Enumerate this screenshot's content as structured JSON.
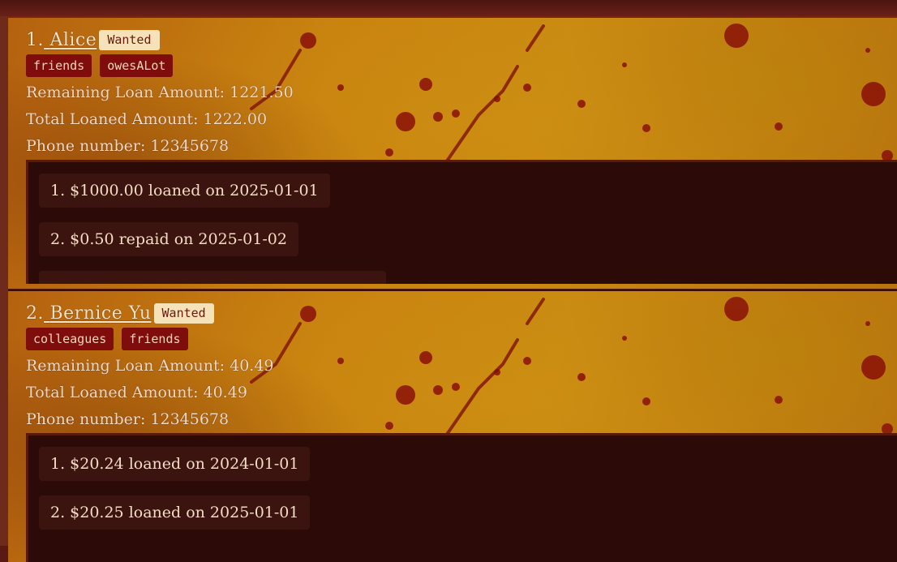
{
  "debtors": [
    {
      "index": "1.",
      "name": "Alice",
      "badge": "Wanted",
      "tags": [
        "friends",
        "owesALot"
      ],
      "remaining_label": "Remaining Loan Amount: 1221.50",
      "total_label": "Total Loaned Amount: 1222.00",
      "phone_label": "Phone number: 12345678",
      "loans": [
        "1. $1000.00 loaned on 2025-01-01",
        "2. $0.50 repaid on 2025-01-02"
      ]
    },
    {
      "index": "2.",
      "name": "Bernice Yu",
      "badge": "Wanted",
      "tags": [
        "colleagues",
        "friends"
      ],
      "remaining_label": "Remaining Loan Amount: 40.49",
      "total_label": "Total Loaned Amount: 40.49",
      "phone_label": "Phone number: 12345678",
      "loans": [
        "1. $20.24 loaned on 2024-01-01",
        "2. $20.25 loaned on 2025-01-01"
      ]
    }
  ],
  "colors": {
    "wanted_badge_bg": "#f6e2b8",
    "tag_bg": "#7e0d0b",
    "loan_panel_bg": "#2c0a07",
    "parchment": "#c8820f"
  }
}
